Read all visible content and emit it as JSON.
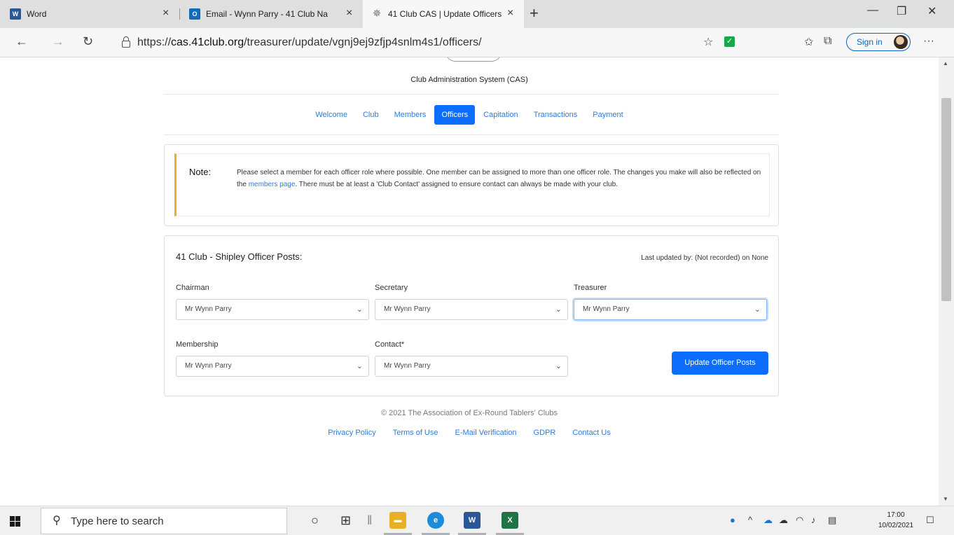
{
  "browser": {
    "tabs": [
      {
        "label": "Word",
        "close": "×"
      },
      {
        "label": "Email - Wynn Parry - 41 Club Na",
        "close": "×"
      },
      {
        "label": "41 Club CAS | Update Officers",
        "close": "×"
      }
    ],
    "new_tab": "+",
    "url_prefix": "https://",
    "url_host": "cas.41club.org",
    "url_path": "/treasurer/update/vgnj9ej9zfjp4snlm4s1/officers/",
    "sign_in": "Sign in",
    "more": "···"
  },
  "site": {
    "title": "Club Administration System (CAS)",
    "menu": [
      "Welcome",
      "Club",
      "Members",
      "Officers",
      "Capitation",
      "Transactions",
      "Payment"
    ],
    "active_menu": "Officers"
  },
  "note": {
    "title": "Note:",
    "text_before_link": "Please select a member for each officer role where possible. One member can be assigned to more than one officer role. The changes you make will also be reflected on the ",
    "link": "members page",
    "text_after_link": ". There must be at least a 'Club Contact' assigned to ensure contact can always be made with your club."
  },
  "officers": {
    "title": "41 Club - Shipley Officer Posts:",
    "last_updated": "Last updated by: (Not recorded) on None",
    "fields": [
      {
        "label": "Chairman",
        "value": "Mr Wynn Parry"
      },
      {
        "label": "Secretary",
        "value": "Mr Wynn Parry"
      },
      {
        "label": "Treasurer",
        "value": "Mr Wynn Parry"
      },
      {
        "label": "Membership",
        "value": "Mr Wynn Parry"
      },
      {
        "label": "Contact*",
        "value": "Mr Wynn Parry"
      }
    ],
    "submit": "Update Officer Posts"
  },
  "footer": {
    "copyright": "© 2021 The Association of Ex-Round Tablers' Clubs",
    "links": [
      "Privacy Policy",
      "Terms of Use",
      "E-Mail Verification",
      "GDPR",
      "Contact Us"
    ]
  },
  "taskbar": {
    "search_placeholder": "Type here to search",
    "time": "17:00",
    "date": "10/02/2021"
  }
}
